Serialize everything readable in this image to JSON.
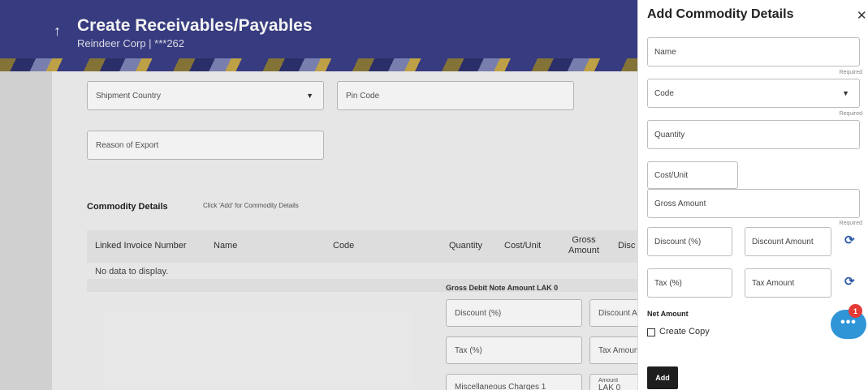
{
  "header": {
    "back_icon": "up-arrow-icon",
    "title": "Create Receivables/Payables",
    "subtitle": "Reindeer Corp | ***262"
  },
  "form": {
    "shipment_country": "Shipment Country",
    "pin_code": "Pin Code",
    "reason_of_export": "Reason of Export"
  },
  "commodity": {
    "title": "Commodity Details",
    "hint": "Click 'Add' for Commodity Details",
    "columns": [
      "Linked Invoice Number",
      "Name",
      "Code",
      "Quantity",
      "Cost/Unit",
      "Gross Amount",
      "Disc"
    ],
    "no_data": "No data to display.",
    "gross_debit": "Gross Debit Note Amount  LAK 0"
  },
  "lower_fields": {
    "discount_pct": "Discount (%)",
    "discount_amount": "Discount Am",
    "tax_pct": "Tax (%)",
    "tax_amount": "Tax Amoun",
    "misc_charges": "Miscellaneous Charges 1",
    "amount_label": "Amount",
    "amount_value": "LAK 0"
  },
  "panel": {
    "title": "Add Commodity Details",
    "close_icon": "close-icon",
    "name": "Name",
    "code": "Code",
    "quantity": "Quantity",
    "cost_unit": "Cost/Unit",
    "gross_amount": "Gross Amount",
    "discount_pct": "Discount (%)",
    "discount_amount": "Discount Amount",
    "tax_pct": "Tax (%)",
    "tax_amount": "Tax Amount",
    "required": "Required",
    "net_amount": "Net Amount",
    "create_copy": "Create Copy",
    "add_button": "Add"
  },
  "chat": {
    "badge_count": "1"
  },
  "colors": {
    "header": "#3a3f86",
    "accent": "#2b5aa8",
    "chat": "#2f95d6",
    "badge": "#e53935"
  }
}
